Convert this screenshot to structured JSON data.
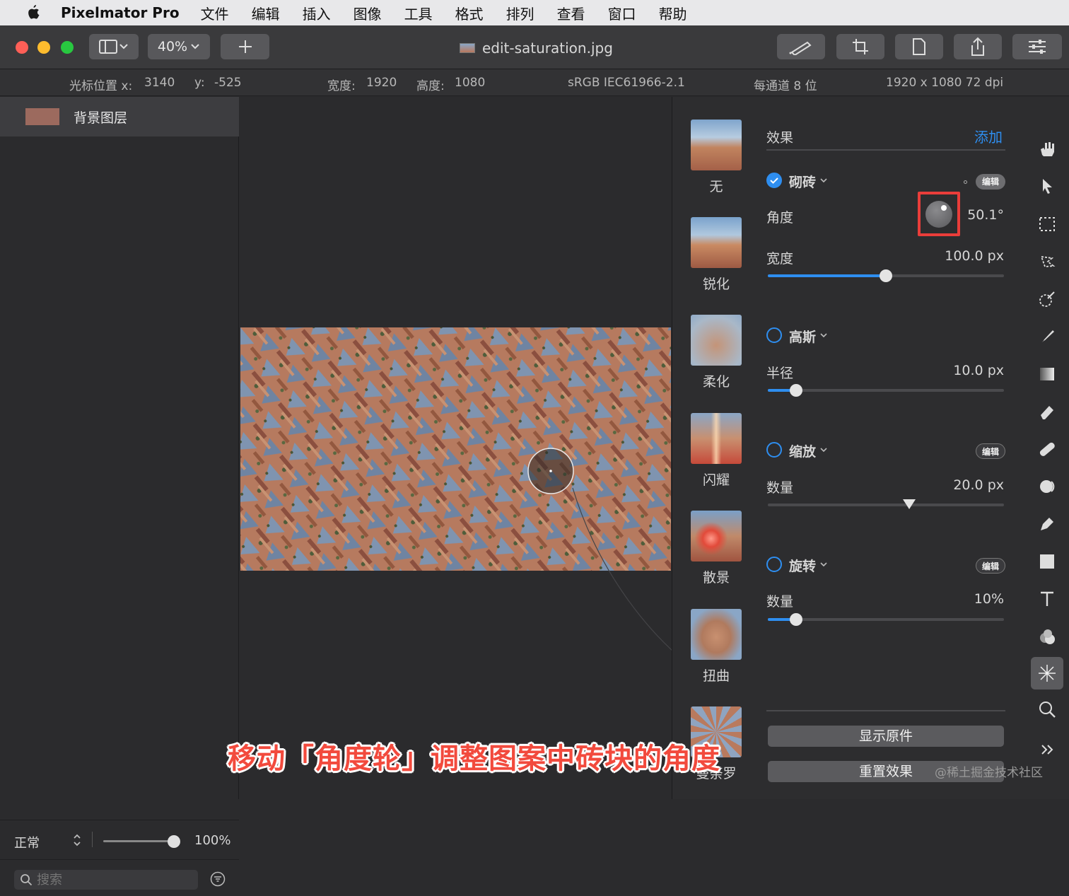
{
  "menubar": {
    "app_name": "Pixelmator Pro",
    "items": [
      "文件",
      "编辑",
      "插入",
      "图像",
      "工具",
      "格式",
      "排列",
      "查看",
      "窗口",
      "帮助"
    ]
  },
  "toolbar": {
    "zoom": "40%",
    "add_icon": "plus-icon",
    "document_title": "edit-saturation.jpg"
  },
  "infobar": {
    "cursor_label": "光标位置 x:",
    "cursor_x": "3140",
    "cursor_y_label": "y:",
    "cursor_y": "-525",
    "width_label": "宽度:",
    "width": "1920",
    "height_label": "高度:",
    "height": "1080",
    "color_profile": "sRGB IEC61966-2.1",
    "bit_depth": "每通道 8 位",
    "dimensions": "1920 x 1080 72 dpi"
  },
  "layers": {
    "items": [
      {
        "name": "背景图层"
      }
    ],
    "blend_mode": "正常",
    "opacity": "100%",
    "opacity_fraction": 1.0,
    "search_placeholder": "搜索"
  },
  "effects_presets": [
    {
      "label": "无"
    },
    {
      "label": "锐化"
    },
    {
      "label": "柔化"
    },
    {
      "label": "闪耀"
    },
    {
      "label": "散景"
    },
    {
      "label": "扭曲"
    },
    {
      "label": "曼荼罗"
    }
  ],
  "settings": {
    "header": "效果",
    "add_label": "添加",
    "edit_badge": "编辑",
    "effects": [
      {
        "name": "砌砖",
        "checked": true,
        "param": "角度",
        "value": "50.1°",
        "param2": "宽度",
        "value2": "100.0 px",
        "fraction2": 0.5
      },
      {
        "name": "高斯",
        "checked": false,
        "param": "半径",
        "value": "10.0 px",
        "fraction": 0.12
      },
      {
        "name": "缩放",
        "checked": false,
        "param": "数量",
        "value": "20.0 px",
        "fraction": 0.6
      },
      {
        "name": "旋转",
        "checked": false,
        "param": "数量",
        "value": "10%",
        "fraction": 0.12
      }
    ],
    "show_original": "显示原件",
    "reset_effects": "重置效果"
  },
  "tools": [
    "hand-icon",
    "arrow-icon",
    "marquee-icon",
    "lasso-icon",
    "magic-wand-icon",
    "brush-icon",
    "gradient-icon",
    "eraser-icon",
    "bandage-icon",
    "clone-icon",
    "pen-icon",
    "shape-icon",
    "text-icon",
    "color-icon",
    "effects-icon",
    "zoom-icon",
    "more-icon"
  ],
  "caption": "移动「角度轮」调整图案中砖块的角度",
  "watermark": "@稀土掘金技术社区",
  "colors": {
    "accent": "#2e8ef0",
    "highlight": "#ea3d3a"
  }
}
